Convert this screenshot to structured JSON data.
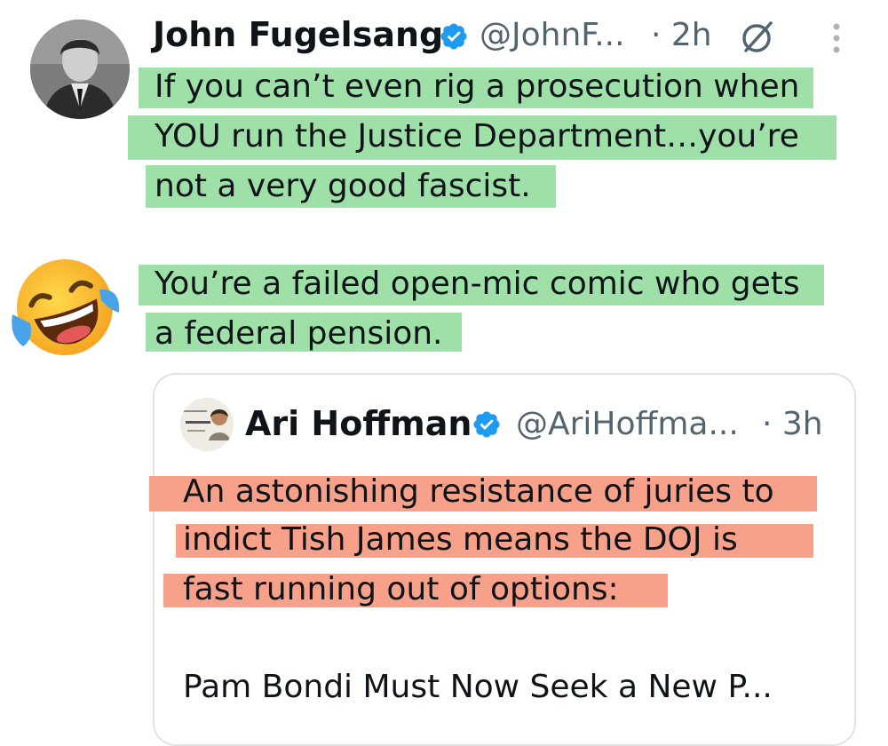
{
  "main_tweet": {
    "author_name": "John Fugelsang",
    "author_handle": "@JohnF...",
    "time": "· 2h",
    "lines": [
      "If you can’t even rig a prosecution when",
      "YOU run the Justice Department…you’re",
      "not a very good fascist.",
      "You’re a failed open-mic comic who gets",
      "a federal pension."
    ]
  },
  "quote_tweet": {
    "author_name": "Ari Hoffman",
    "author_handle": "@AriHoffma...",
    "time": "· 3h",
    "lines": [
      "An astonishing resistance of juries to",
      "indict Tish James means the DOJ is",
      "fast running out of options:"
    ],
    "link_title": "Pam Bondi Must Now Seek a New P..."
  },
  "icons": {
    "verified": "verified-badge-icon",
    "grok": "grok-icon",
    "more": "more-vertical-icon",
    "emoji": "laughing-crying-emoji"
  },
  "colors": {
    "highlight_green": "#9fdfa8",
    "highlight_orange": "#f7a08a",
    "verified_blue": "#1d9bf0",
    "secondary_text": "#536471",
    "card_border": "#dfe3e6"
  }
}
